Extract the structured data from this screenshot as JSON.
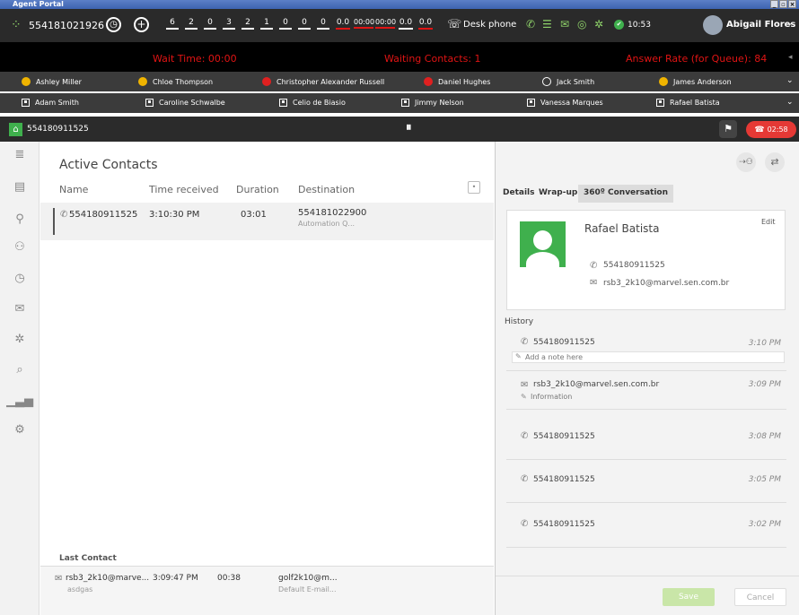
{
  "window": {
    "title": "Agent Portal",
    "minimize": "_",
    "restore": "▫",
    "close": "×"
  },
  "topbar": {
    "agent_id": "554181021926",
    "stats": [
      "6",
      "2",
      "0",
      "3",
      "2",
      "1",
      "0",
      "0",
      "0",
      "0.0",
      "00:00",
      "00:00",
      "0.0",
      "0.0"
    ],
    "phone_mode": "Desk phone",
    "time": "10:53",
    "user_name": "Abigail Flores"
  },
  "banner": {
    "wait_time": "Wait Time: 00:00",
    "waiting_contacts": "Waiting Contacts: 1",
    "answer_rate": "Answer Rate (for Queue): 84"
  },
  "agents_row1": [
    {
      "name": "Ashley Miller",
      "status_color": "#f0b400"
    },
    {
      "name": "Chloe Thompson",
      "status_color": "#f0b400"
    },
    {
      "name": "Christopher Alexander Russell",
      "status_color": "#e02020"
    },
    {
      "name": "Daniel Hughes",
      "status_color": "#e02020"
    },
    {
      "name": "Jack Smith",
      "status_color": ""
    },
    {
      "name": "James Anderson",
      "status_color": "#f0b400"
    }
  ],
  "agents_row2": [
    {
      "name": "Adam Smith"
    },
    {
      "name": "Caroline Schwalbe"
    },
    {
      "name": "Celio de Biasio"
    },
    {
      "name": "Jimmy Nelson"
    },
    {
      "name": "Vanessa Marques"
    },
    {
      "name": "Rafael Batista"
    }
  ],
  "callbar": {
    "number": "554180911525",
    "timer": "02:58"
  },
  "active_contacts": {
    "title": "Active Contacts",
    "columns": [
      "Name",
      "Time received",
      "Duration",
      "Destination"
    ],
    "rows": [
      {
        "name": "554180911525",
        "time": "3:10:30 PM",
        "duration": "03:01",
        "destination": "554181022900",
        "destination_sub": "Automation Q..."
      }
    ],
    "last_contact_title": "Last Contact",
    "last": {
      "name": "rsb3_2k10@marve...",
      "name_sub": "asdgas",
      "time": "3:09:47 PM",
      "duration": "00:38",
      "destination": "golf2k10@m...",
      "destination_sub": "Default E-mail..."
    }
  },
  "right": {
    "tabs": [
      "Details",
      "Wrap-up",
      "360º Conversation"
    ],
    "contact_name": "Rafael Batista",
    "edit_label": "Edit",
    "phone": "554180911525",
    "email": "rsb3_2k10@marvel.sen.com.br",
    "history_title": "History",
    "note_placeholder": "Add a note here",
    "history": [
      {
        "label": "554180911525",
        "time": "3:10 PM",
        "kind": "phone"
      },
      {
        "label": "rsb3_2k10@marvel.sen.com.br",
        "time": "3:09 PM",
        "kind": "email",
        "sub": "Information"
      },
      {
        "label": "554180911525",
        "time": "3:08 PM",
        "kind": "phone"
      },
      {
        "label": "554180911525",
        "time": "3:05 PM",
        "kind": "phone"
      },
      {
        "label": "554180911525",
        "time": "3:02 PM",
        "kind": "phone"
      }
    ],
    "save_label": "Save",
    "cancel_label": "Cancel"
  },
  "colors": {
    "accent_green": "#3fb04d",
    "alert_red": "#e01414",
    "hangup": "#e53935"
  }
}
